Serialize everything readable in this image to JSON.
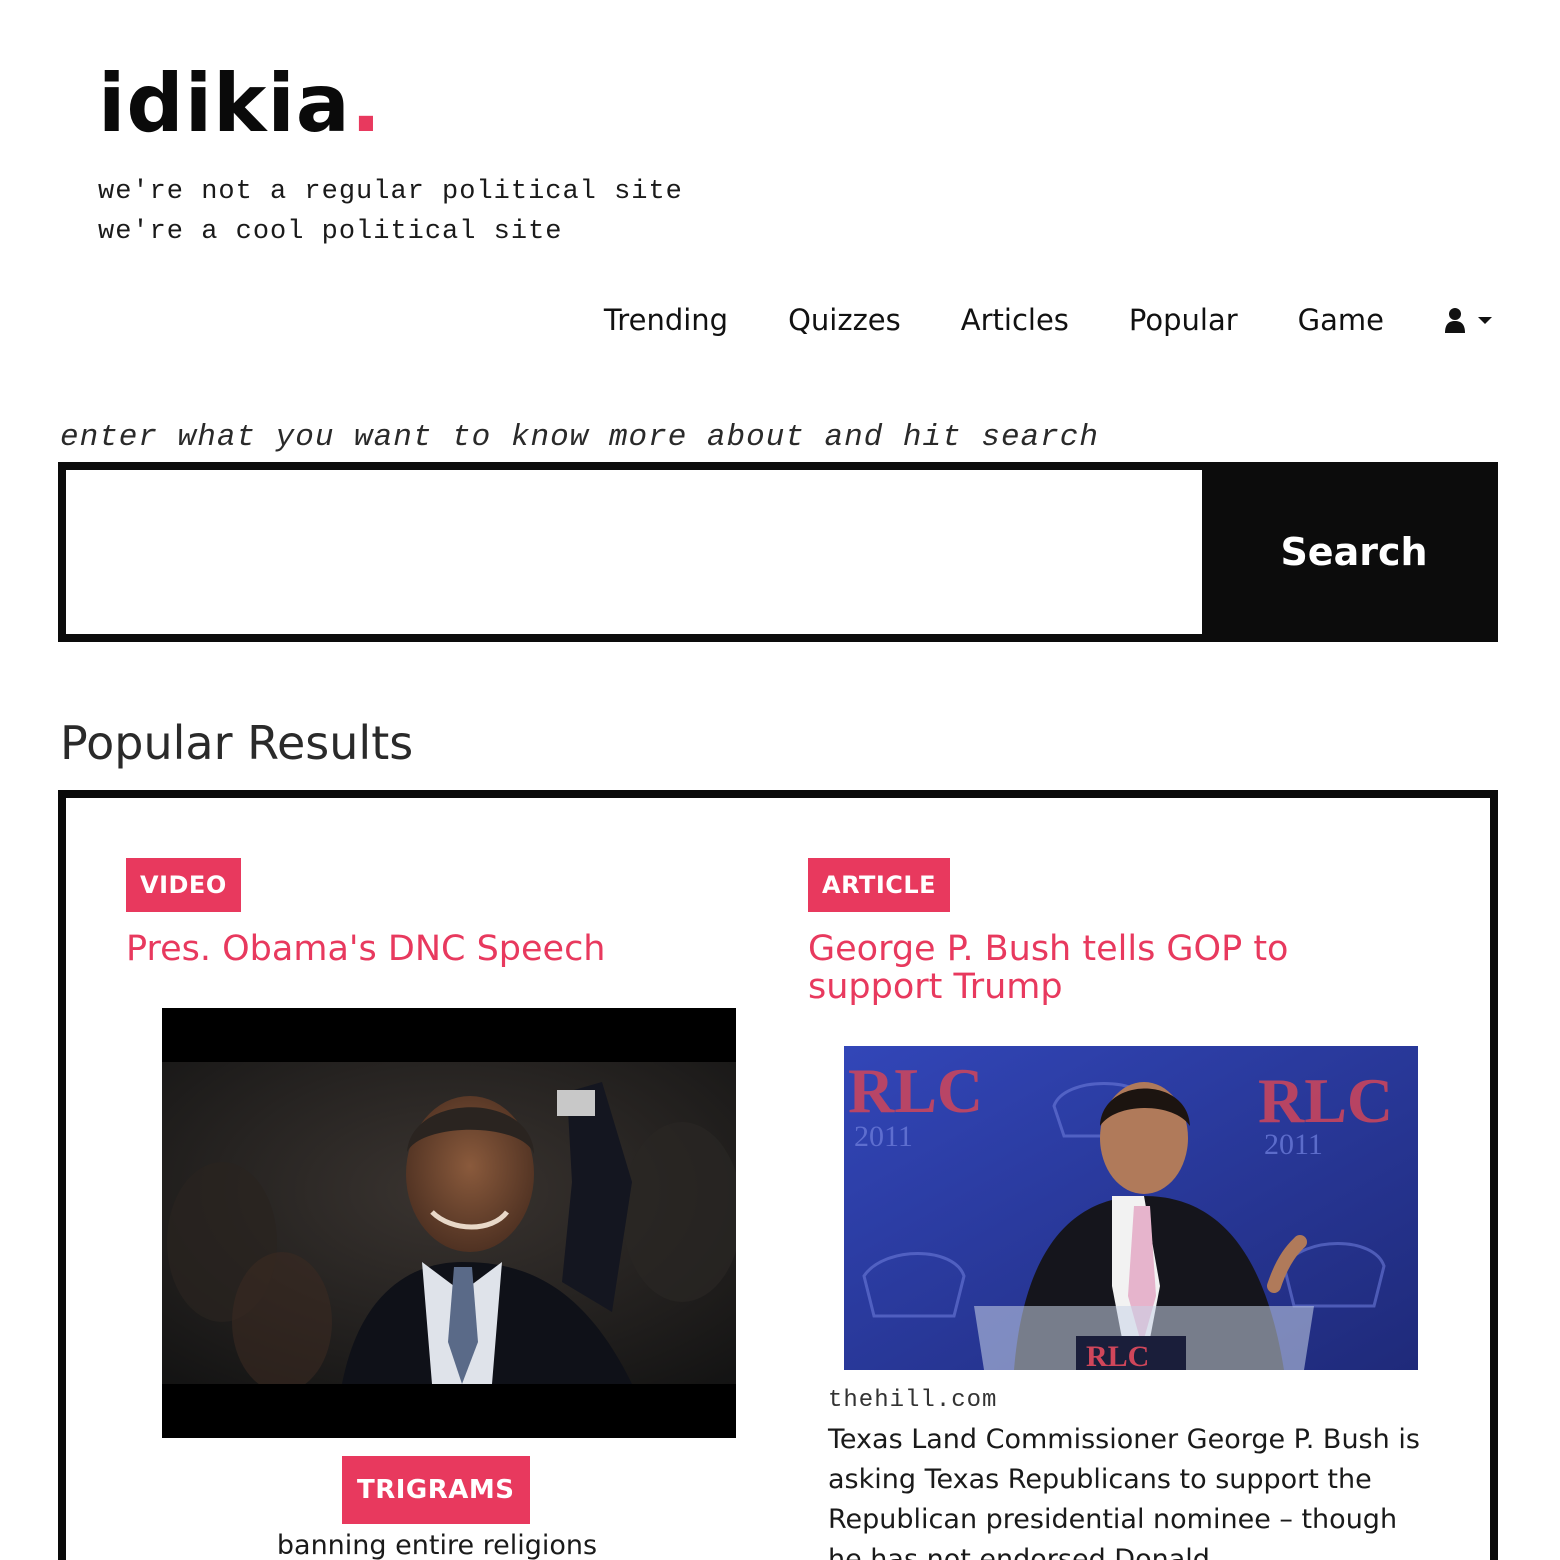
{
  "brand": {
    "logo_text": "idikia",
    "logo_dot": ".",
    "tagline_line1": "we're not a regular political site",
    "tagline_line2": "we're a cool political site",
    "accent_color": "#e8395e"
  },
  "nav": {
    "items": [
      {
        "label": "Trending"
      },
      {
        "label": "Quizzes"
      },
      {
        "label": "Articles"
      },
      {
        "label": "Popular"
      },
      {
        "label": "Game"
      }
    ],
    "user_menu_icon": "user-icon",
    "user_menu_caret": "caret-down-icon"
  },
  "search": {
    "hint": "enter what you want to know more about and hit search",
    "value": "",
    "button_label": "Search"
  },
  "popular": {
    "title": "Popular Results",
    "cards": [
      {
        "type_label": "VIDEO",
        "title": "Pres. Obama's DNC Speech",
        "media": "video-thumbnail",
        "tag_label": "TRIGRAMS",
        "tag_text": "banning entire religions"
      },
      {
        "type_label": "ARTICLE",
        "title": "George P. Bush tells GOP to support Trump",
        "media": "article-photo",
        "source": "thehill.com",
        "excerpt": "Texas Land Commissioner George P. Bush is asking Texas Republicans to support the Republican presidential nominee – though he has not endorsed Donald"
      }
    ]
  }
}
